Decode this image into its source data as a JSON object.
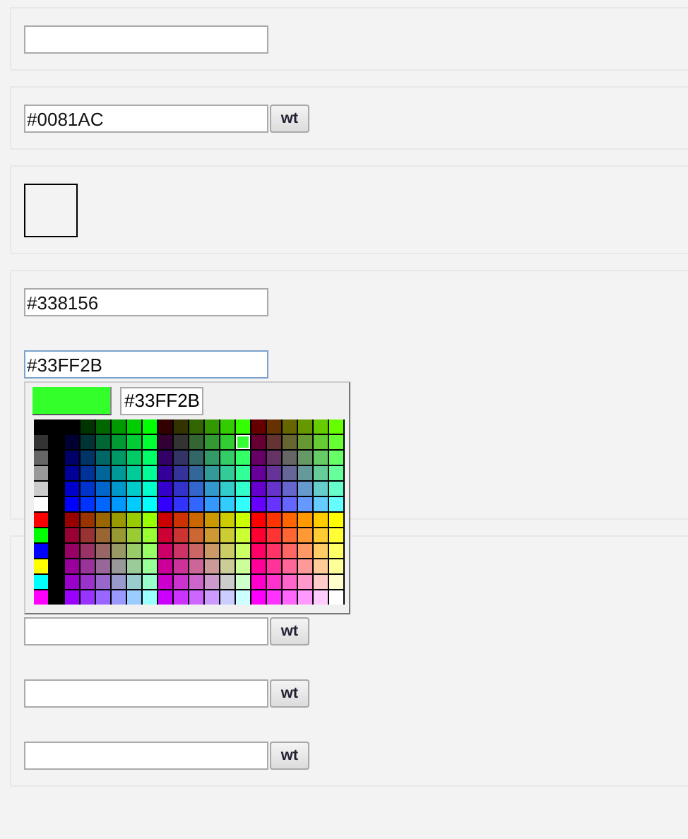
{
  "panels": [
    {
      "items": [
        {
          "kind": "field",
          "focused": false
        }
      ]
    },
    {
      "items": [
        {
          "kind": "field",
          "value": "#0081AC",
          "focused": false,
          "button_label": "wt"
        }
      ]
    },
    {
      "items": [
        {
          "kind": "swatch"
        }
      ]
    },
    {
      "items": [
        {
          "kind": "field",
          "value": "#338156",
          "focused": false
        },
        {
          "kind": "field",
          "value": "#33FF2B",
          "focused": true,
          "picker": {
            "kind": "web-safe",
            "preview": {
              "color": "#33ff2b"
            },
            "hex": "#33FF2B",
            "selected_swatch": {
              "color": "#33ff33"
            }
          }
        }
      ]
    },
    {
      "items": [
        {
          "kind": "field",
          "focused": false,
          "button_label": "wt"
        },
        {
          "kind": "field",
          "focused": false,
          "button_label": "wt"
        },
        {
          "kind": "field",
          "focused": false,
          "button_label": "wt"
        }
      ]
    }
  ]
}
